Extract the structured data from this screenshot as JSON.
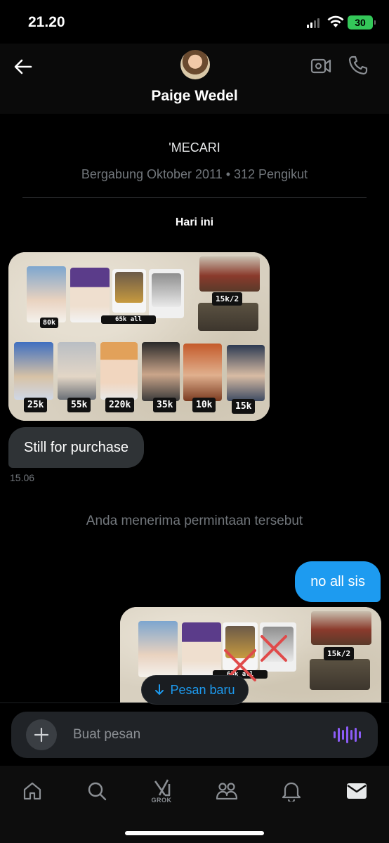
{
  "status_bar": {
    "time": "21.20",
    "battery": "30"
  },
  "header": {
    "name": "Paige Wedel",
    "back_icon": "arrow-left-icon",
    "video_icon": "video-call-icon",
    "phone_icon": "phone-icon"
  },
  "profile": {
    "handle": "'MECARI",
    "joined": "Bergabung Oktober 2011 • 312 Pengikut"
  },
  "conversation": {
    "day_label": "Hari ini",
    "image1_tags": [
      "80k",
      "65k all",
      "15k/2",
      "25k",
      "55k",
      "220k",
      "35k",
      "10k",
      "15k"
    ],
    "image2_tags": [
      "15k/2",
      "65k all"
    ],
    "incoming_text": "Still for purchase",
    "incoming_time": "15.06",
    "system_notice": "Anda menerima permintaan tersebut",
    "outgoing_text": "no all sis",
    "new_message_pill": "Pesan baru"
  },
  "composer": {
    "placeholder": "Buat pesan"
  },
  "tabbar": {
    "grok_label": "GROK"
  },
  "colors": {
    "accent": "#1d9bf0",
    "bubble_in": "#2f3336",
    "voice": "#8b5cf6"
  }
}
